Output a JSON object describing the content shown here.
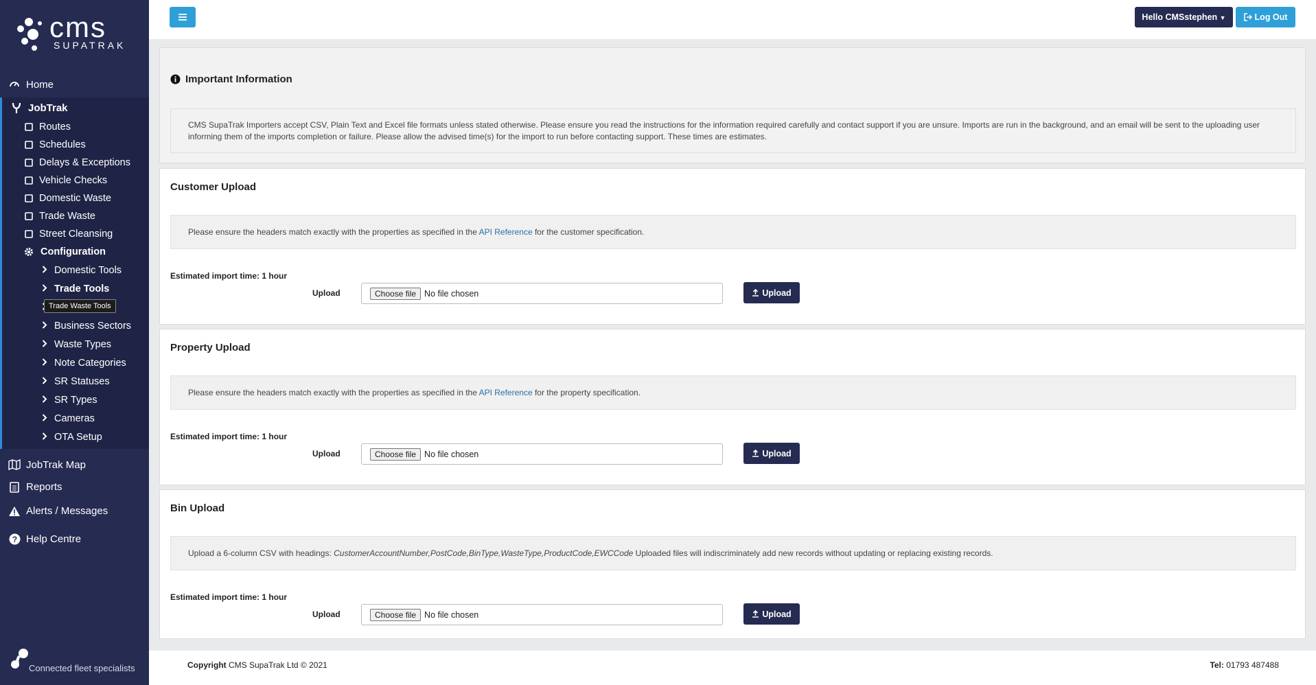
{
  "brand": {
    "name": "cms",
    "sub": "SUPATRAK",
    "tagline": "Connected fleet specialists"
  },
  "sidebar": {
    "home": "Home",
    "jobtrak": "JobTrak",
    "jobtrak_items": [
      "Routes",
      "Schedules",
      "Delays & Exceptions",
      "Vehicle Checks",
      "Domestic Waste",
      "Trade Waste",
      "Street Cleansing"
    ],
    "configuration": "Configuration",
    "config_items": [
      "Domestic Tools",
      "Trade Tools",
      "",
      "Business Sectors",
      "Waste Types",
      "Note Categories",
      "SR Statuses",
      "SR Types",
      "Cameras",
      "OTA Setup"
    ],
    "tooltip": "Trade Waste Tools",
    "jobtrak_map": "JobTrak Map",
    "reports": "Reports",
    "alerts": "Alerts / Messages",
    "help": "Help Centre"
  },
  "topbar": {
    "hello": "Hello CMSstephen",
    "logout": "Log Out"
  },
  "info": {
    "title": "Important Information",
    "text": "CMS SupaTrak Importers accept CSV, Plain Text and Excel file formats unless stated otherwise. Please ensure you read the instructions for the information required carefully and contact support if you are unsure. Imports are run in the background, and an email will be sent to the uploading user informing them of the imports completion or failure. Please allow the advised time(s) for the import to run before contacting support. These times are estimates."
  },
  "customer": {
    "title": "Customer Upload",
    "note_pre": "Please ensure the headers match exactly with the properties as specified in the ",
    "note_link": "API Reference",
    "note_post": " for the customer specification.",
    "est": "Estimated import time: 1 hour"
  },
  "property": {
    "title": "Property Upload",
    "note_pre": "Please ensure the headers match exactly with the properties as specified in the ",
    "note_link": "API Reference",
    "note_post": " for the property specification.",
    "est": "Estimated import time: 1 hour"
  },
  "bin": {
    "title": "Bin Upload",
    "note_pre": "Upload a 6-column CSV with headings: ",
    "note_italic": "CustomerAccountNumber,PostCode,BinType,WasteType,ProductCode,EWCCode",
    "note_post": " Uploaded files will indiscriminately add new records without updating or replacing existing records.",
    "est": "Estimated import time: 1 hour"
  },
  "upload_form": {
    "label": "Upload",
    "choose": "Choose file",
    "no_file": "No file chosen",
    "button": "Upload"
  },
  "footer": {
    "copyright_label": "Copyright",
    "copyright_text": " CMS SupaTrak Ltd © 2021",
    "tel_label": "Tel:",
    "tel": " 01793 487488"
  }
}
